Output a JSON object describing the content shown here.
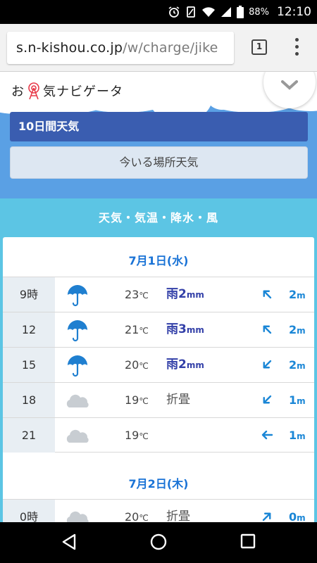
{
  "status_bar": {
    "battery": "88%",
    "time": "12:10",
    "icons": [
      "alarm-icon",
      "vibrate-icon",
      "wifi-icon",
      "signal-icon",
      "battery-icon"
    ]
  },
  "browser": {
    "url_domain": "s.n-kishou.co.jp",
    "url_path": "/w/charge/jike",
    "tab_count": "1"
  },
  "site": {
    "logo_text_1": "お",
    "logo_text_2": "気ナビゲータ"
  },
  "buttons": {
    "ten_day": "10日間天気",
    "current_location": "今いる場所天気"
  },
  "section": {
    "title": "天気・気温・降水・風"
  },
  "days": [
    {
      "date": "7月1日(水)",
      "rows": [
        {
          "time": "9時",
          "weather": "umbrella",
          "temp": "23",
          "temp_unit": "℃",
          "precip": "雨2",
          "precip_unit": "mm",
          "wind_dir": "nw",
          "wind": "2",
          "wind_unit": "m"
        },
        {
          "time": "12",
          "weather": "umbrella",
          "temp": "21",
          "temp_unit": "℃",
          "precip": "雨3",
          "precip_unit": "mm",
          "wind_dir": "nw",
          "wind": "2",
          "wind_unit": "m"
        },
        {
          "time": "15",
          "weather": "umbrella",
          "temp": "20",
          "temp_unit": "℃",
          "precip": "雨2",
          "precip_unit": "mm",
          "wind_dir": "sw",
          "wind": "2",
          "wind_unit": "m"
        },
        {
          "time": "18",
          "weather": "cloud",
          "temp": "19",
          "temp_unit": "℃",
          "precip": "折畳",
          "precip_unit": "",
          "wind_dir": "sw",
          "wind": "1",
          "wind_unit": "m"
        },
        {
          "time": "21",
          "weather": "cloud",
          "temp": "19",
          "temp_unit": "℃",
          "precip": "",
          "precip_unit": "",
          "wind_dir": "w",
          "wind": "1",
          "wind_unit": "m"
        }
      ]
    },
    {
      "date": "7月2日(木)",
      "rows": [
        {
          "time": "0時",
          "weather": "cloud",
          "temp": "20",
          "temp_unit": "℃",
          "precip": "折畳",
          "precip_unit": "",
          "wind_dir": "ne",
          "wind": "0",
          "wind_unit": "m"
        }
      ]
    }
  ],
  "colors": {
    "sky": "#5aa0e4",
    "section_bg": "#5cc5e4",
    "ten_day_button": "#3a5db0",
    "date_text": "#1a73d6",
    "rain_text": "#3340a8",
    "wind_text": "#1a86d6"
  }
}
